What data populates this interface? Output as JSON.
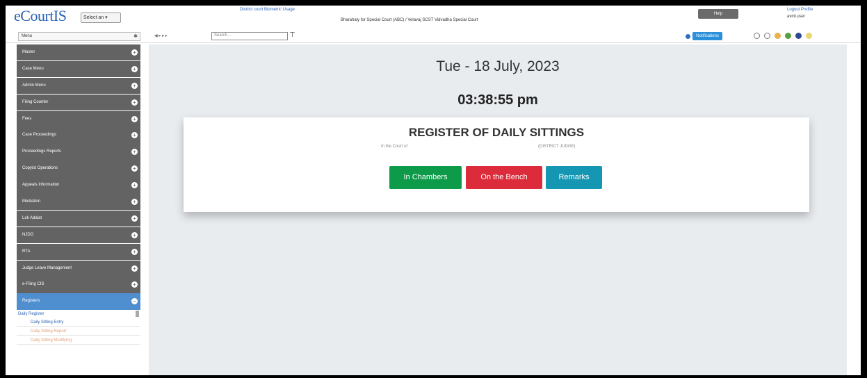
{
  "header": {
    "logo": "eCourtIS",
    "logo_select": "Select an ▾",
    "top_link": "District court Biometric Usage",
    "caption": "Bharahaly for Special Court (ABC) / Velavaj SCST Vidvadha Special Court",
    "grey_button": "Help",
    "logout": "Logout Profile",
    "user": "avml.user"
  },
  "toolbar": {
    "menu_label": "Menu",
    "nav": "◀ ▸ ▸ ▸",
    "search_placeholder": "Search...",
    "badge": "Notifications",
    "theme_colors": [
      "#ffffff",
      "#ffffff",
      "#e8b34a",
      "#5a9f3e",
      "#2f4a8c",
      "#e9d86f"
    ]
  },
  "sidebar": {
    "items": [
      "Master",
      "Case Menu",
      "Admin Menu",
      "Filing Counter",
      "Fees",
      "Case Proceedings",
      "Proceedings Reports",
      "Copyist Operations",
      "Appeals Information",
      "Mediation",
      "Lok Adalat",
      "NJDG",
      "RTA",
      "Judge Leave Management",
      "e-Filing CIS",
      "Registers"
    ],
    "active_index": 15,
    "sub_head": "Daily Register",
    "sub_links": [
      "Daily Sitting Entry",
      "Daily Sitting Report",
      "Daily Sitting Modifying"
    ]
  },
  "main": {
    "date": "Tue - 18 July, 2023",
    "time": "03:38:55 pm",
    "card": {
      "title": "REGISTER OF DAILY SITTINGS",
      "court_label": "In the Court of",
      "court_value": "(DISTRICT JUDGE)",
      "buttons": {
        "chambers": "In Chambers",
        "bench": "On the Bench",
        "remarks": "Remarks"
      }
    }
  }
}
